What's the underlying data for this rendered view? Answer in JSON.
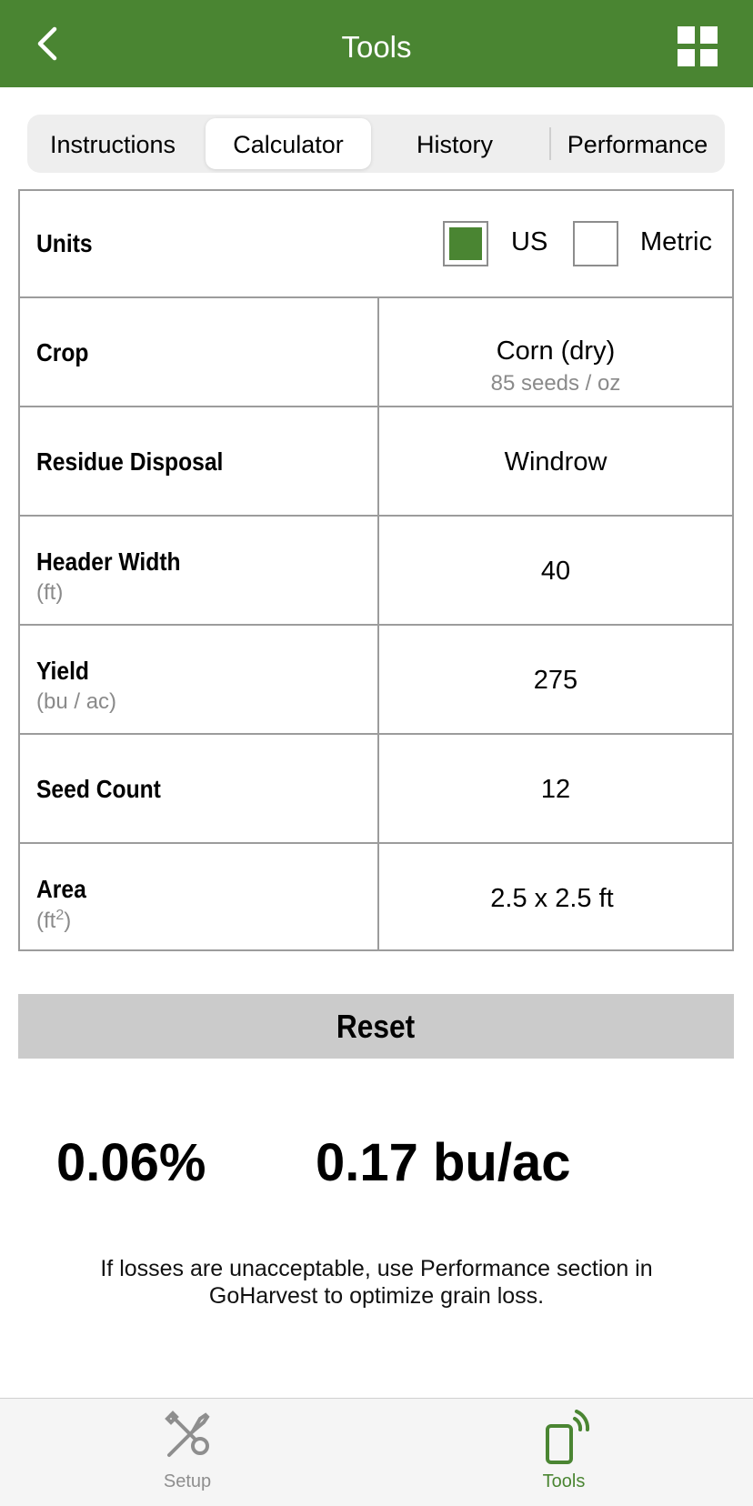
{
  "header": {
    "title": "Tools",
    "back_icon": "chevron-left-icon",
    "menu_icon": "grid-icon",
    "color": "#4a8532"
  },
  "tabs": [
    {
      "label": "Instructions",
      "active": false
    },
    {
      "label": "Calculator",
      "active": true
    },
    {
      "label": "History",
      "active": false
    },
    {
      "label": "Performance",
      "active": false
    }
  ],
  "units": {
    "label": "Units",
    "options": [
      {
        "label": "US",
        "checked": true
      },
      {
        "label": "Metric",
        "checked": false
      }
    ]
  },
  "rows": {
    "crop": {
      "label": "Crop",
      "value": "Corn (dry)",
      "subvalue": "85 seeds / oz"
    },
    "residue": {
      "label": "Residue Disposal",
      "value": "Windrow"
    },
    "header_width": {
      "label": "Header Width",
      "unit": "(ft)",
      "value": "40"
    },
    "yield": {
      "label": "Yield",
      "unit": "(bu / ac)",
      "value": "275"
    },
    "seed_count": {
      "label": "Seed Count",
      "value": "12"
    },
    "area": {
      "label": "Area",
      "unit_prefix": "(ft",
      "unit_sup": "2",
      "unit_suffix": ")",
      "value": "2.5 x 2.5 ft"
    }
  },
  "reset_label": "Reset",
  "results": {
    "percent": "0.06%",
    "rate": "0.17 bu/ac"
  },
  "note": "If losses are unacceptable, use Performance section in GoHarvest to optimize grain loss.",
  "tabbar": [
    {
      "label": "Setup",
      "icon": "tools-icon",
      "active": false,
      "color": "#8e8e8e"
    },
    {
      "label": "Tools",
      "icon": "phone-signal-icon",
      "active": true,
      "color": "#4a8532"
    }
  ]
}
